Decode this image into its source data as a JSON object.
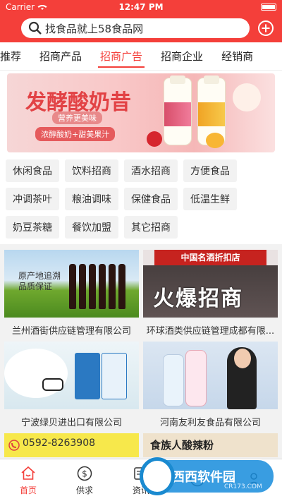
{
  "status_bar": {
    "carrier": "Carrier",
    "time": "12:47 PM"
  },
  "search": {
    "placeholder": "找食品就上58食品网"
  },
  "tabs": [
    {
      "label": "推荐"
    },
    {
      "label": "招商产品"
    },
    {
      "label": "招商广告"
    },
    {
      "label": "招商企业"
    },
    {
      "label": "经销商"
    }
  ],
  "active_tab": "招商广告",
  "banner": {
    "title": "发酵酸奶昔",
    "subtitle": "营养更美味",
    "tagline": "浓醇酸奶+甜美果汁"
  },
  "categories": [
    {
      "label": "休闲食品"
    },
    {
      "label": "饮料招商"
    },
    {
      "label": "酒水招商"
    },
    {
      "label": "方便食品"
    },
    {
      "label": "冲调茶叶"
    },
    {
      "label": "粮油调味"
    },
    {
      "label": "保健食品"
    },
    {
      "label": "低温生鲜"
    },
    {
      "label": "奶豆茶糖"
    },
    {
      "label": "餐饮加盟"
    },
    {
      "label": "其它招商"
    }
  ],
  "companies": [
    {
      "name": "兰州酒街供应链管理有限公司",
      "image_text": "原产地追溯\n品质保证"
    },
    {
      "name": "环球酒类供应链管理成都有限...",
      "image_sign": "中国名酒折扣店",
      "image_text": "火爆招商"
    },
    {
      "name": "宁波绿贝进出口有限公司"
    },
    {
      "name": "河南友利友食品有限公司"
    },
    {
      "name": "",
      "image_text": "0592-8263908"
    },
    {
      "name": "",
      "image_text": "食族人酸辣粉"
    }
  ],
  "tabbar": [
    {
      "label": "首页",
      "icon": "home-icon"
    },
    {
      "label": "供求",
      "icon": "dollar-icon"
    },
    {
      "label": "资讯",
      "icon": "news-icon"
    },
    {
      "label": "",
      "icon": "discover-icon"
    },
    {
      "label": "",
      "icon": "me-icon"
    }
  ],
  "watermark": {
    "text": "西西软件园",
    "url": "CR173.COM"
  },
  "colors": {
    "brand": "#f43f3a"
  }
}
